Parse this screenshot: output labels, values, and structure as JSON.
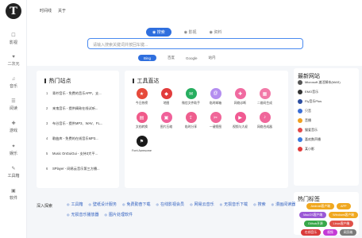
{
  "sidebar": {
    "logo": "T",
    "items": [
      {
        "label": "影视",
        "icon": "☐",
        "icon_name": "video-icon"
      },
      {
        "label": "二次元",
        "icon": "♥",
        "icon_name": "heart-icon"
      },
      {
        "label": "音乐",
        "icon": "♫",
        "icon_name": "music-icon"
      },
      {
        "label": "阅读",
        "icon": "☰",
        "icon_name": "book-icon"
      },
      {
        "label": "游戏",
        "icon": "✚",
        "icon_name": "game-icon"
      },
      {
        "label": "娱乐",
        "icon": "✦",
        "icon_name": "fun-icon"
      },
      {
        "label": "工具箱",
        "icon": "✎",
        "icon_name": "toolbox-icon"
      },
      {
        "label": "软件",
        "icon": "▣",
        "icon_name": "software-icon"
      }
    ]
  },
  "topnav": [
    "时间线",
    "关于"
  ],
  "search": {
    "tabs": [
      {
        "label": "搜索",
        "icon": "◉"
      },
      {
        "label": "影视",
        "icon": "◉"
      },
      {
        "label": "资料",
        "icon": "◉"
      }
    ],
    "placeholder": "请输入搜索关键词并按回车键...",
    "engines": [
      "Bing",
      "百度",
      "Google",
      "站内"
    ]
  },
  "hot": {
    "title": "热门站点",
    "items": [
      {
        "num": "1",
        "text": "青柠音乐 - 免费的音乐APP，支..."
      },
      {
        "num": "2",
        "text": "来鬼音乐 - 提供精致在线试听..."
      },
      {
        "num": "3",
        "text": "布谷音乐 - 提供MP3、WAV、FL..."
      },
      {
        "num": "4",
        "text": "歌曲库 - 免费的在线音乐MP3..."
      },
      {
        "num": "5",
        "text": "Music OnGuiGui - 支持3大平..."
      },
      {
        "num": "6",
        "text": "SPlayer - 网易云音乐第三方播..."
      }
    ]
  },
  "tools": {
    "title": "工具直达",
    "items": [
      {
        "label": "今日热榜",
        "color": "#e64a3b",
        "icon": "★",
        "icon_name": "fire-icon"
      },
      {
        "label": "地图",
        "color": "#e23c3c",
        "icon": "◆",
        "icon_name": "map-icon"
      },
      {
        "label": "微信文件助手",
        "color": "#27ae60",
        "icon": "✉",
        "icon_name": "wechat-icon"
      },
      {
        "label": "临时邮箱",
        "color": "#b48ef0",
        "icon": "@",
        "icon_name": "mail-icon"
      },
      {
        "label": "网络诊断",
        "color": "#f06aa0",
        "icon": "✚",
        "icon_name": "diagnose-icon"
      },
      {
        "label": "二维码生成",
        "color": "#f27aa8",
        "icon": "▦",
        "icon_name": "qrcode-icon"
      },
      {
        "label": "文档转换",
        "color": "#f05a8a",
        "icon": "▤",
        "icon_name": "doc-convert-icon"
      },
      {
        "label": "图片压缩",
        "color": "#f0619a",
        "icon": "▣",
        "icon_name": "image-compress-icon"
      },
      {
        "label": "临时分享",
        "color": "#ee5e8e",
        "icon": "⇪",
        "icon_name": "share-icon"
      },
      {
        "label": "一键抠图",
        "color": "#f06699",
        "icon": "✂",
        "icon_name": "cutout-icon"
      },
      {
        "label": "视频与大叔",
        "color": "#f05a92",
        "icon": "▶",
        "icon_name": "video-tool-icon"
      },
      {
        "label": "网络合成器",
        "color": "#f0679b",
        "icon": "♪",
        "icon_name": "synth-icon"
      },
      {
        "label": "Font Awesome",
        "color": "#1a1a1a",
        "icon": "⚑",
        "icon_name": "font-awesome-icon"
      }
    ]
  },
  "newsites": {
    "title": "最新网站",
    "items": [
      {
        "text": "Microsoft 激活脚本(MAS)",
        "color": "#555555"
      },
      {
        "text": "EMO音乐",
        "color": "#333333"
      },
      {
        "text": "Fly音乐Plus",
        "color": "#2d4ea0"
      },
      {
        "text": "只音",
        "color": "#3b6fd6"
      },
      {
        "text": "音播",
        "color": "#f0a020"
      },
      {
        "text": "猫爱音乐",
        "color": "#e24a4a"
      },
      {
        "text": "喜欢数声播",
        "color": "#3a7ae0"
      },
      {
        "text": "某小影",
        "color": "#e03c3c"
      }
    ]
  },
  "tags": {
    "title": "热门标签",
    "items": [
      {
        "text": "Android客户端",
        "color": "#f0a820"
      },
      {
        "text": "APP",
        "color": "#f0a820"
      },
      {
        "text": "MacOS客户端",
        "color": "#9b59d6"
      },
      {
        "text": "Windows客户端",
        "color": "#f0a820"
      },
      {
        "text": "Github开源",
        "color": "#37a84a"
      },
      {
        "text": "Linux客户端",
        "color": "#e0524a"
      },
      {
        "text": "在线音乐",
        "color": "#d93a3a"
      },
      {
        "text": "视频",
        "color": "#c43ad6"
      },
      {
        "text": "网页端",
        "color": "#7a7a7a"
      }
    ]
  },
  "explore": {
    "label": "深入探索",
    "links": [
      "工具箱",
      "壁纸设计服务",
      "免费勤奋下载",
      "在线影视会员",
      "网易云音乐",
      "无损音乐下载",
      "搜索",
      "漫画阅读器",
      "无损音乐播放器",
      "图片处理软件"
    ]
  }
}
